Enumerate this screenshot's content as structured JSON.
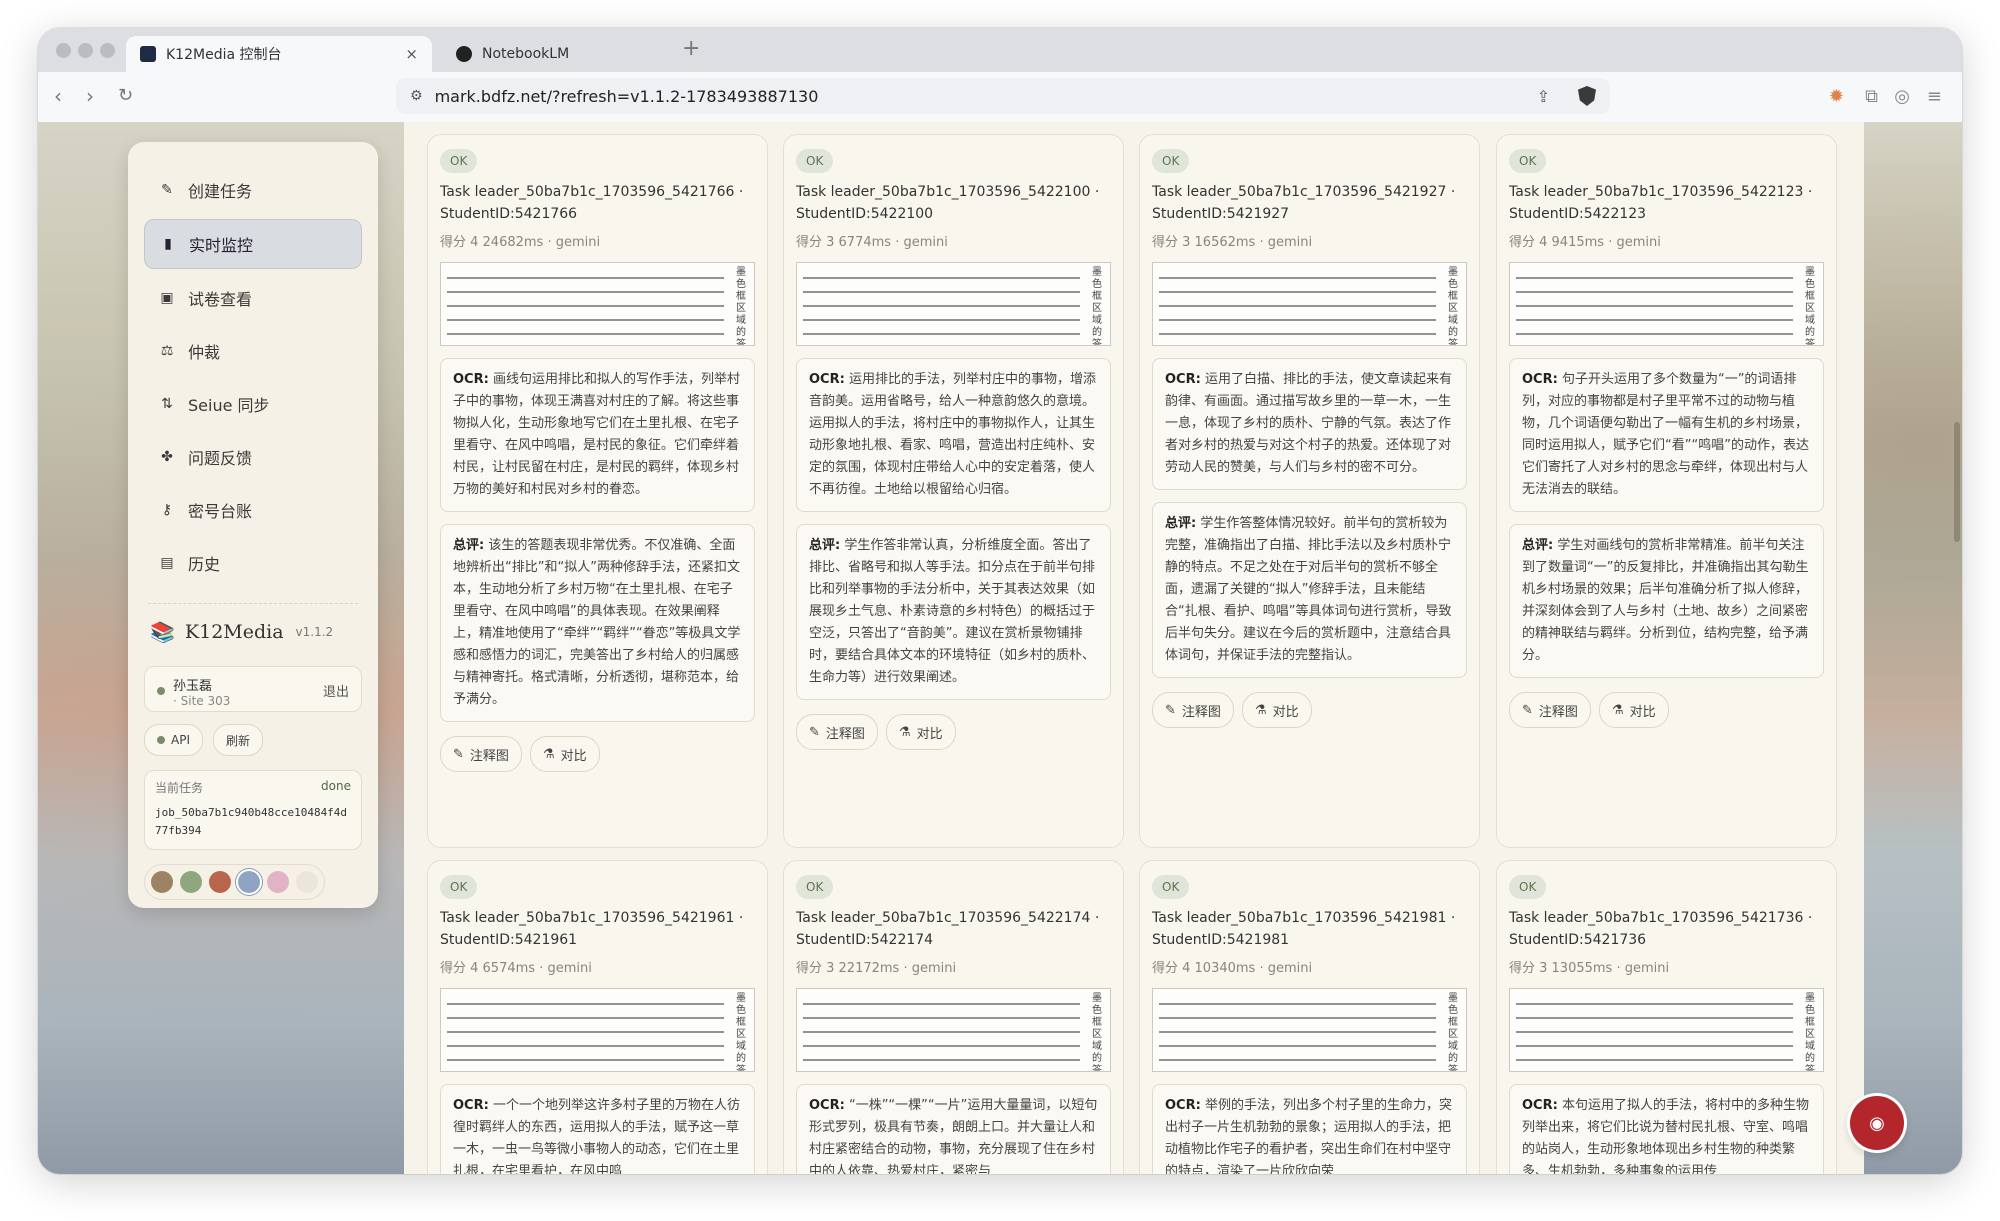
{
  "browser": {
    "tabs": [
      {
        "title": "K12Media 控制台",
        "active": true,
        "icon": "k12media-favicon"
      },
      {
        "title": "NotebookLM",
        "active": false,
        "icon": "notebooklm-icon"
      }
    ],
    "url": "mark.bdfz.net/?refresh=v1.1.2-1783493887130",
    "tab_close": "×",
    "new_tab": "+",
    "nav": {
      "back": "‹",
      "forward": "›",
      "reload": "↻"
    }
  },
  "sidebar": {
    "items": [
      {
        "label": "创建任务",
        "icon": "pencil-icon",
        "glyph": "✎",
        "active": false
      },
      {
        "label": "实时监控",
        "icon": "bar-chart-icon",
        "glyph": "▮",
        "active": true
      },
      {
        "label": "试卷查看",
        "icon": "image-icon",
        "glyph": "▣",
        "active": false
      },
      {
        "label": "仲裁",
        "icon": "scale-icon",
        "glyph": "⚖",
        "active": false
      },
      {
        "label": "Seiue 同步",
        "icon": "sync-icon",
        "glyph": "⇅",
        "active": false
      },
      {
        "label": "问题反馈",
        "icon": "clover-icon",
        "glyph": "✤",
        "active": false
      },
      {
        "label": "密号台账",
        "icon": "key-icon",
        "glyph": "⚷",
        "active": false
      },
      {
        "label": "历史",
        "icon": "calendar-icon",
        "glyph": "▤",
        "active": false
      }
    ],
    "brand": {
      "name": "K12Media",
      "version": "v1.1.2",
      "logo": "books-icon"
    },
    "user": {
      "name": "孙玉磊",
      "site": "· Site 303",
      "logout": "退出"
    },
    "api_label": "API",
    "refresh_label": "刷新",
    "task": {
      "label": "当前任务",
      "status": "done",
      "id": "job_50ba7b1c940b48cce10484f4d77fb394"
    },
    "swatches": [
      "#9c8462",
      "#8fa77e",
      "#b8654b",
      "#8fa4c2",
      "#e2b3c4",
      "#ebe6dc"
    ],
    "selected_swatch": 3
  },
  "cards": [
    {
      "status": "OK",
      "title": "Task leader_50ba7b1c_1703596_5421766 · StudentID:5421766",
      "meta": "得分 4  24682ms · gemini",
      "ocr_label": "OCR:",
      "ocr": "画线句运用排比和拟人的写作手法，列举村子中的事物，体现王满喜对村庄的了解。将这些事物拟人化，生动形象地写它们在土里扎根、在宅子里看守、在风中鸣唱，是村民的象征。它们牵绊着村民，让村民留在村庄，是村民的羁绊，体现乡村万物的美好和村民对乡村的眷恋。",
      "comment_label": "总评:",
      "comment": "该生的答题表现非常优秀。不仅准确、全面地辨析出“排比”和“拟人”两种修辞手法，还紧扣文本，生动地分析了乡村万物“在土里扎根、在宅子里看守、在风中鸣唱”的具体表现。在效果阐释上，精准地使用了“牵绊”“羁绊”“眷恋”等极具文学感和感悟力的词汇，完美答出了乡村给人的归属感与精神寄托。格式清晰，分析透彻，堪称范本，给予满分。",
      "btn_annot": "注释图",
      "btn_compare": "对比"
    },
    {
      "status": "OK",
      "title": "Task leader_50ba7b1c_1703596_5422100 · StudentID:5422100",
      "meta": "得分 3  6774ms · gemini",
      "ocr_label": "OCR:",
      "ocr": "运用排比的手法，列举村庄中的事物，增添音韵美。运用省略号，给人一种意韵悠久的意境。运用拟人的手法，将村庄中的事物拟作人，让其生动形象地扎根、看家、鸣唱，营造出村庄纯朴、安定的氛围，体现村庄带给人心中的安定着落，使人不再彷徨。土地给以根留给心归宿。",
      "comment_label": "总评:",
      "comment": "学生作答非常认真，分析维度全面。答出了排比、省略号和拟人等手法。扣分点在于前半句排比和列举事物的手法分析中，关于其表达效果（如展现乡土气息、朴素诗意的乡村特色）的概括过于空泛，只答出了“音韵美”。建议在赏析景物铺排时，要结合具体文本的环境特征（如乡村的质朴、生命力等）进行效果阐述。",
      "btn_annot": "注释图",
      "btn_compare": "对比"
    },
    {
      "status": "OK",
      "title": "Task leader_50ba7b1c_1703596_5421927 · StudentID:5421927",
      "meta": "得分 3  16562ms · gemini",
      "ocr_label": "OCR:",
      "ocr": "运用了白描、排比的手法，使文章读起来有韵律、有画面。通过描写故乡里的一草一木，一生一息，体现了乡村的质朴、宁静的气氛。表达了作者对乡村的热爱与对这个村子的热爱。还体现了对劳动人民的赞美，与人们与乡村的密不可分。",
      "comment_label": "总评:",
      "comment": "学生作答整体情况较好。前半句的赏析较为完整，准确指出了白描、排比手法以及乡村质朴宁静的特点。不足之处在于对后半句的赏析不够全面，遗漏了关键的“拟人”修辞手法，且未能结合“扎根、看护、鸣唱”等具体词句进行赏析，导致后半句失分。建议在今后的赏析题中，注意结合具体词句，并保证手法的完整指认。",
      "btn_annot": "注释图",
      "btn_compare": "对比"
    },
    {
      "status": "OK",
      "title": "Task leader_50ba7b1c_1703596_5422123 · StudentID:5422123",
      "meta": "得分 4  9415ms · gemini",
      "ocr_label": "OCR:",
      "ocr": "句子开头运用了多个数量为“一”的词语排列，对应的事物都是村子里平常不过的动物与植物，几个词语便勾勒出了一幅有生机的乡村场景，同时运用拟人，赋予它们“看”“鸣唱”的动作，表达它们寄托了人对乡村的思念与牵绊，体现出村与人无法消去的联结。",
      "comment_label": "总评:",
      "comment": "学生对画线句的赏析非常精准。前半句关注到了数量词“一”的反复排比，并准确指出其勾勒生机乡村场景的效果；后半句准确分析了拟人修辞，并深刻体会到了人与乡村（土地、故乡）之间紧密的精神联结与羁绊。分析到位，结构完整，给予满分。",
      "btn_annot": "注释图",
      "btn_compare": "对比"
    },
    {
      "status": "OK",
      "title": "Task leader_50ba7b1c_1703596_5421961 · StudentID:5421961",
      "meta": "得分 4  6574ms · gemini",
      "ocr_label": "OCR:",
      "ocr": "一个一个地列举这许多村子里的万物在人彷徨时羁绊人的东西，运用拟人的手法，赋予这一草一木，一虫一鸟等微小事物人的动态，它们在土里扎根，在宅里看护，在风中鸣",
      "comment_label": "",
      "comment": "",
      "btn_annot": "",
      "btn_compare": ""
    },
    {
      "status": "OK",
      "title": "Task leader_50ba7b1c_1703596_5422174 · StudentID:5422174",
      "meta": "得分 3  22172ms · gemini",
      "ocr_label": "OCR:",
      "ocr": "“一株”“一棵”“一片”运用大量量词，以短句形式罗列，极具有节奏，朗朗上口。并大量让人和村庄紧密结合的动物，事物，充分展现了住在乡村中的人依靠、热爱村庄，紧密与",
      "comment_label": "",
      "comment": "",
      "btn_annot": "",
      "btn_compare": ""
    },
    {
      "status": "OK",
      "title": "Task leader_50ba7b1c_1703596_5421981 · StudentID:5421981",
      "meta": "得分 4  10340ms · gemini",
      "ocr_label": "OCR:",
      "ocr": "举例的手法，列出多个村子里的生命力，突出村子一片生机勃勃的景象；运用拟人的手法，把动植物比作宅子的看护者，突出生命们在村中坚守的特点，渲染了一片欣欣向荣",
      "comment_label": "",
      "comment": "",
      "btn_annot": "",
      "btn_compare": ""
    },
    {
      "status": "OK",
      "title": "Task leader_50ba7b1c_1703596_5421736 · StudentID:5421736",
      "meta": "得分 3  13055ms · gemini",
      "ocr_label": "OCR:",
      "ocr": "本句运用了拟人的手法，将村中的多种生物列举出来，将它们比说为替村民扎根、守室、鸣唱的站岗人，生动形象地体现出乡村生物的种类繁多、生机勃勃，多种事象的运用传",
      "comment_label": "",
      "comment": "",
      "btn_annot": "",
      "btn_compare": ""
    }
  ],
  "thumb_side_text": "墨色框区域的答"
}
